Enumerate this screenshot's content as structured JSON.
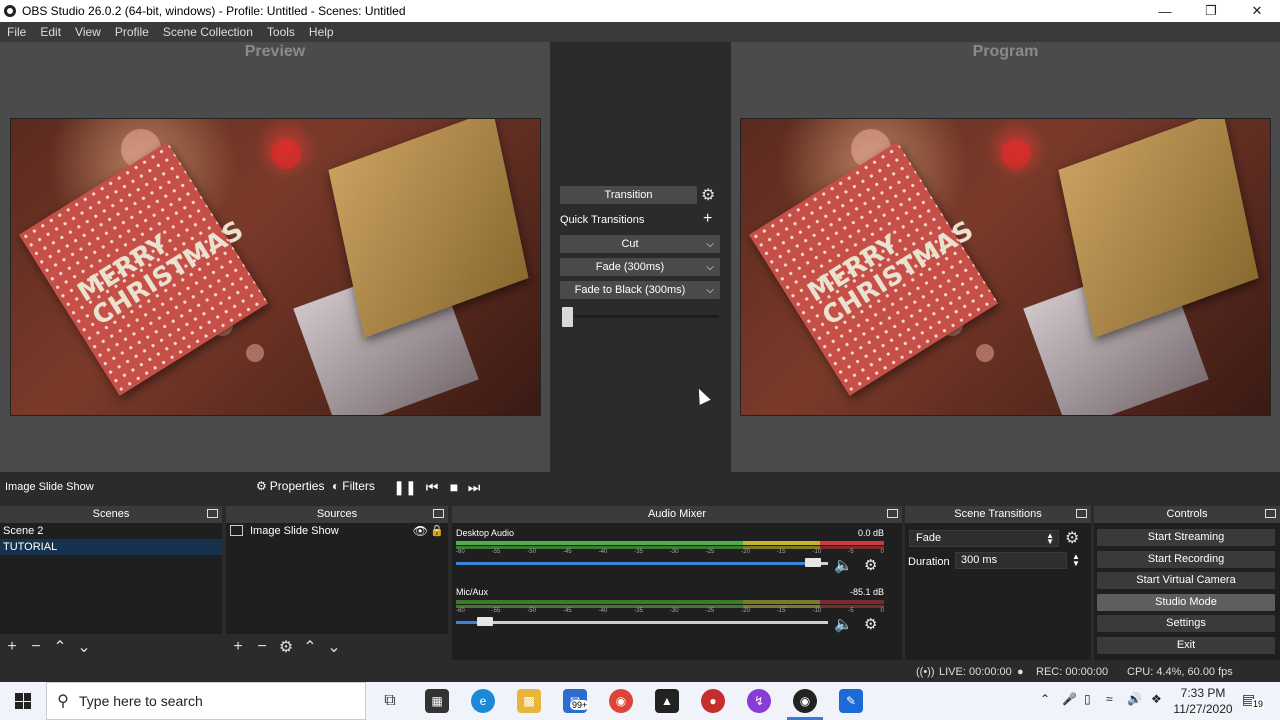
{
  "window": {
    "title": "OBS Studio 26.0.2 (64-bit, windows) - Profile: Untitled - Scenes: Untitled"
  },
  "menu": [
    "File",
    "Edit",
    "View",
    "Profile",
    "Scene Collection",
    "Tools",
    "Help"
  ],
  "preview": {
    "label": "Preview"
  },
  "program": {
    "label": "Program"
  },
  "image": {
    "card_text_1": "MERRY",
    "card_text_2": "CHRISTMAS"
  },
  "transitions_panel": {
    "transition_button": "Transition",
    "quick_transitions_label": "Quick Transitions",
    "quick": [
      "Cut",
      "Fade (300ms)",
      "Fade to Black (300ms)"
    ],
    "tbar_position": 0.0
  },
  "source_toolbar": {
    "source_name": "Image Slide Show",
    "properties_label": "Properties",
    "filters_label": "Filters"
  },
  "docks": {
    "scenes": {
      "title": "Scenes",
      "items": [
        "Scene 2",
        "TUTORIAL"
      ],
      "selected": "TUTORIAL"
    },
    "sources": {
      "title": "Sources",
      "items": [
        "Image Slide Show"
      ]
    },
    "audio_mixer": {
      "title": "Audio Mixer",
      "channels": [
        {
          "name": "Desktop Audio",
          "db": "0.0 dB",
          "volume": 0.98
        },
        {
          "name": "Mic/Aux",
          "db": "-85.1 dB",
          "volume": 0.06
        }
      ],
      "scale": [
        "-60",
        "-55",
        "-50",
        "-45",
        "-40",
        "-35",
        "-30",
        "-25",
        "-20",
        "-15",
        "-10",
        "-5",
        "0"
      ]
    },
    "scene_transitions": {
      "title": "Scene Transitions",
      "transition": "Fade",
      "duration_label": "Duration",
      "duration_value": "300 ms"
    },
    "controls": {
      "title": "Controls",
      "buttons": [
        "Start Streaming",
        "Start Recording",
        "Start Virtual Camera",
        "Studio Mode",
        "Settings",
        "Exit"
      ]
    }
  },
  "status": {
    "live": "LIVE: 00:00:00",
    "rec": "REC: 00:00:00",
    "cpu": "CPU: 4.4%, 60.00 fps"
  },
  "taskbar": {
    "search_placeholder": "Type here to search",
    "mail_badge": "99+",
    "time": "7:33 PM",
    "date": "11/27/2020",
    "notification_count": "19"
  },
  "colors": {
    "selected_scene": "#16324f",
    "volume_fill": "#3a86d8",
    "taskbar": "#f0f3f9"
  }
}
